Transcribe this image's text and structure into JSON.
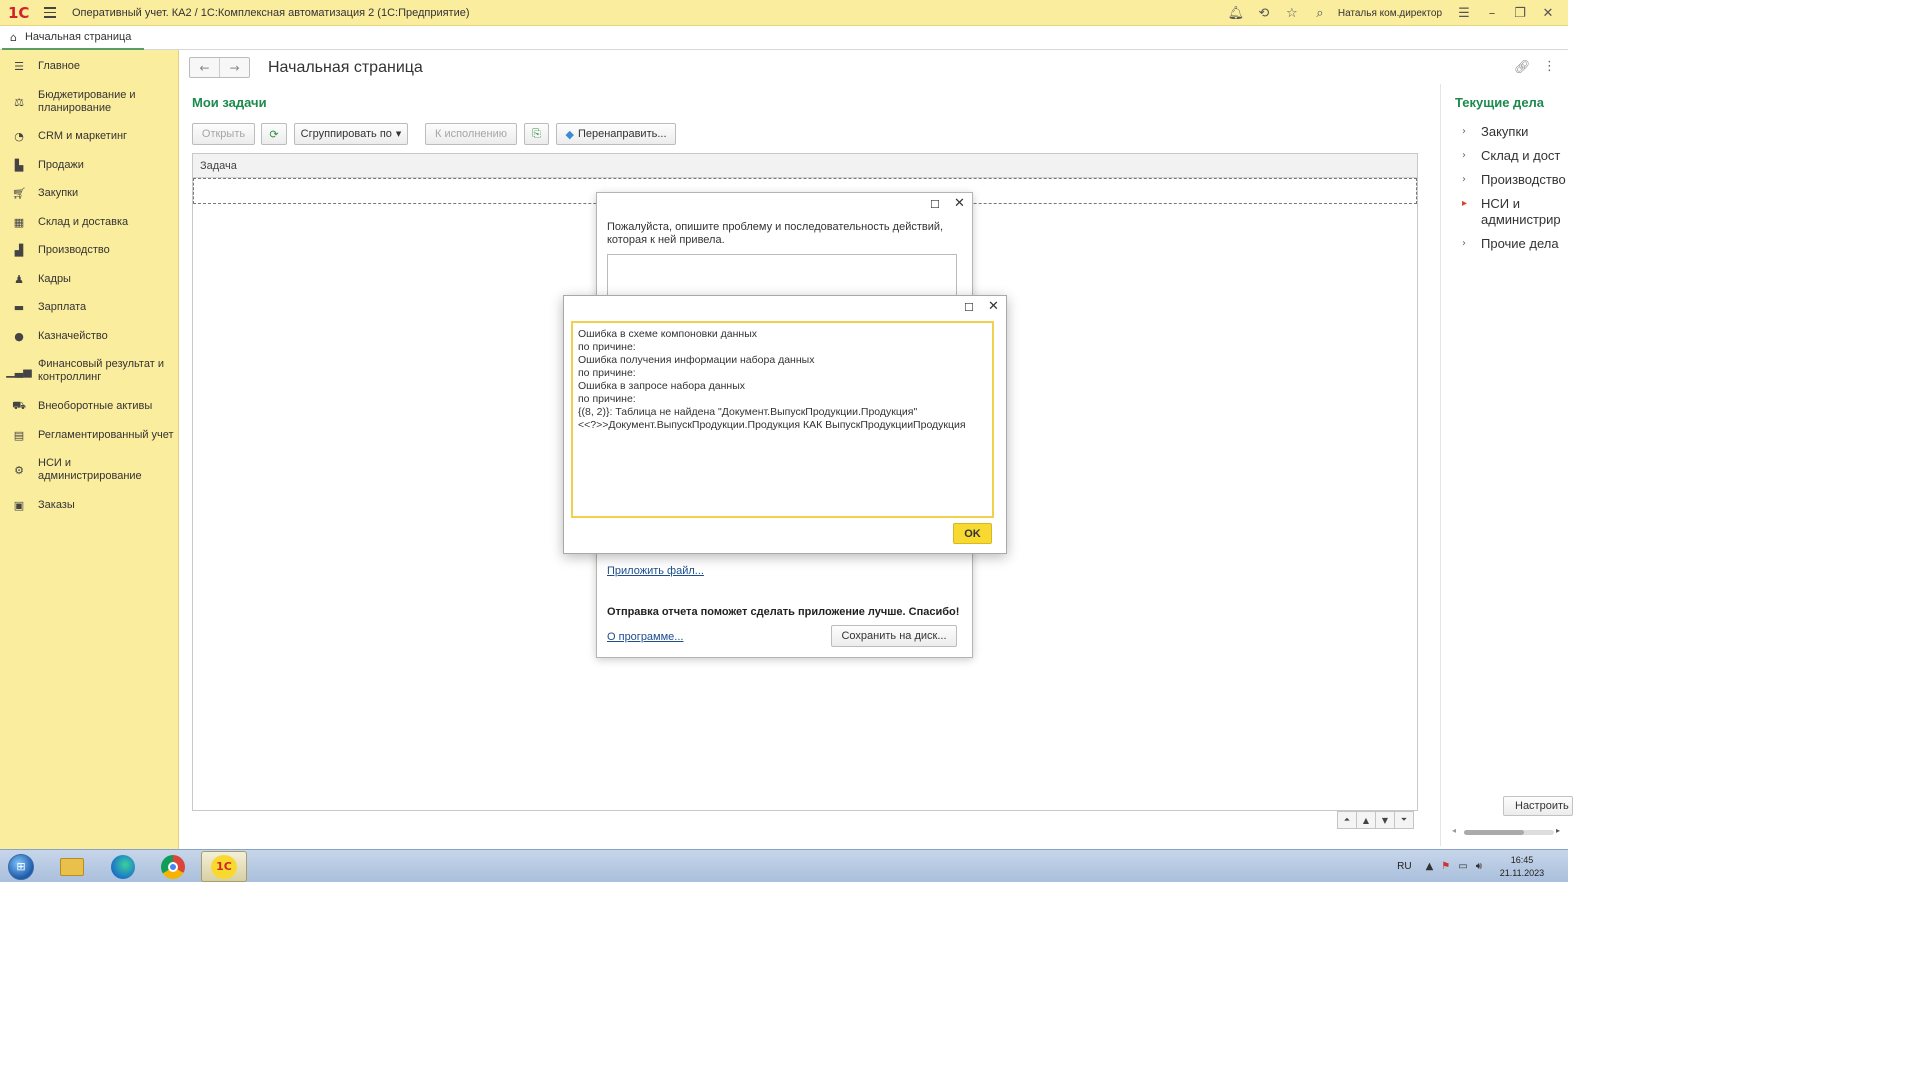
{
  "titlebar": {
    "logo": "1С",
    "title": "Оперативный учет. КА2 / 1С:Комплексная автоматизация 2  (1С:Предприятие)",
    "user": "Наталья ком.директор"
  },
  "tabs": [
    {
      "label": "Начальная страница"
    }
  ],
  "sidebar": {
    "items": [
      {
        "label": "Главное",
        "icon": "menu-icon"
      },
      {
        "label": "Бюджетирование и планирование",
        "icon": "budget-icon"
      },
      {
        "label": "CRM и маркетинг",
        "icon": "pie-chart-icon"
      },
      {
        "label": "Продажи",
        "icon": "bag-icon"
      },
      {
        "label": "Закупки",
        "icon": "cart-icon"
      },
      {
        "label": "Склад и доставка",
        "icon": "warehouse-icon"
      },
      {
        "label": "Производство",
        "icon": "factory-icon"
      },
      {
        "label": "Кадры",
        "icon": "person-icon"
      },
      {
        "label": "Зарплата",
        "icon": "wallet-icon"
      },
      {
        "label": "Казначейство",
        "icon": "coin-icon"
      },
      {
        "label": "Финансовый результат и контроллинг",
        "icon": "bar-chart-icon"
      },
      {
        "label": "Внеоборотные активы",
        "icon": "truck-icon"
      },
      {
        "label": "Регламентированный учет",
        "icon": "document-icon"
      },
      {
        "label": "НСИ и администрирование",
        "icon": "gear-icon"
      },
      {
        "label": "Заказы",
        "icon": "calendar-icon"
      }
    ]
  },
  "main": {
    "page_title": "Начальная страница",
    "my_tasks": {
      "title": "Мои задачи",
      "toolbar": {
        "open": "Открыть",
        "group_by": "Сгруппировать по",
        "to_execution": "К исполнению",
        "redirect": "Перенаправить..."
      },
      "column_header": "Задача"
    }
  },
  "right_panel": {
    "title": "Текущие дела",
    "items": [
      {
        "label": "Закупки"
      },
      {
        "label": "Склад и дост"
      },
      {
        "label": "Производство"
      },
      {
        "label": "НСИ и администрир"
      },
      {
        "label": "Прочие дела"
      }
    ],
    "configure": "Настроить"
  },
  "report_dialog": {
    "description": "Пожалуйста, опишите проблему и последовательность действий, которая к ней привела.",
    "attach_file": "Приложить файл...",
    "thanks": "Отправка отчета поможет сделать приложение лучше. Спасибо!",
    "about": "О программе...",
    "save_to_disk": "Сохранить на диск..."
  },
  "error_dialog": {
    "lines": [
      "Ошибка в схеме компоновки данных",
      "по причине:",
      "Ошибка получения информации набора данных",
      "по причине:",
      "Ошибка в запросе набора данных",
      "по причине:",
      "{(8, 2)}: Таблица не найдена \"Документ.ВыпускПродукции.Продукция\"",
      "<<?>>Документ.ВыпускПродукции.Продукция КАК ВыпускПродукцииПродукция"
    ],
    "ok": "OK"
  },
  "taskbar": {
    "lang": "RU",
    "time": "16:45",
    "date": "21.11.2023"
  }
}
